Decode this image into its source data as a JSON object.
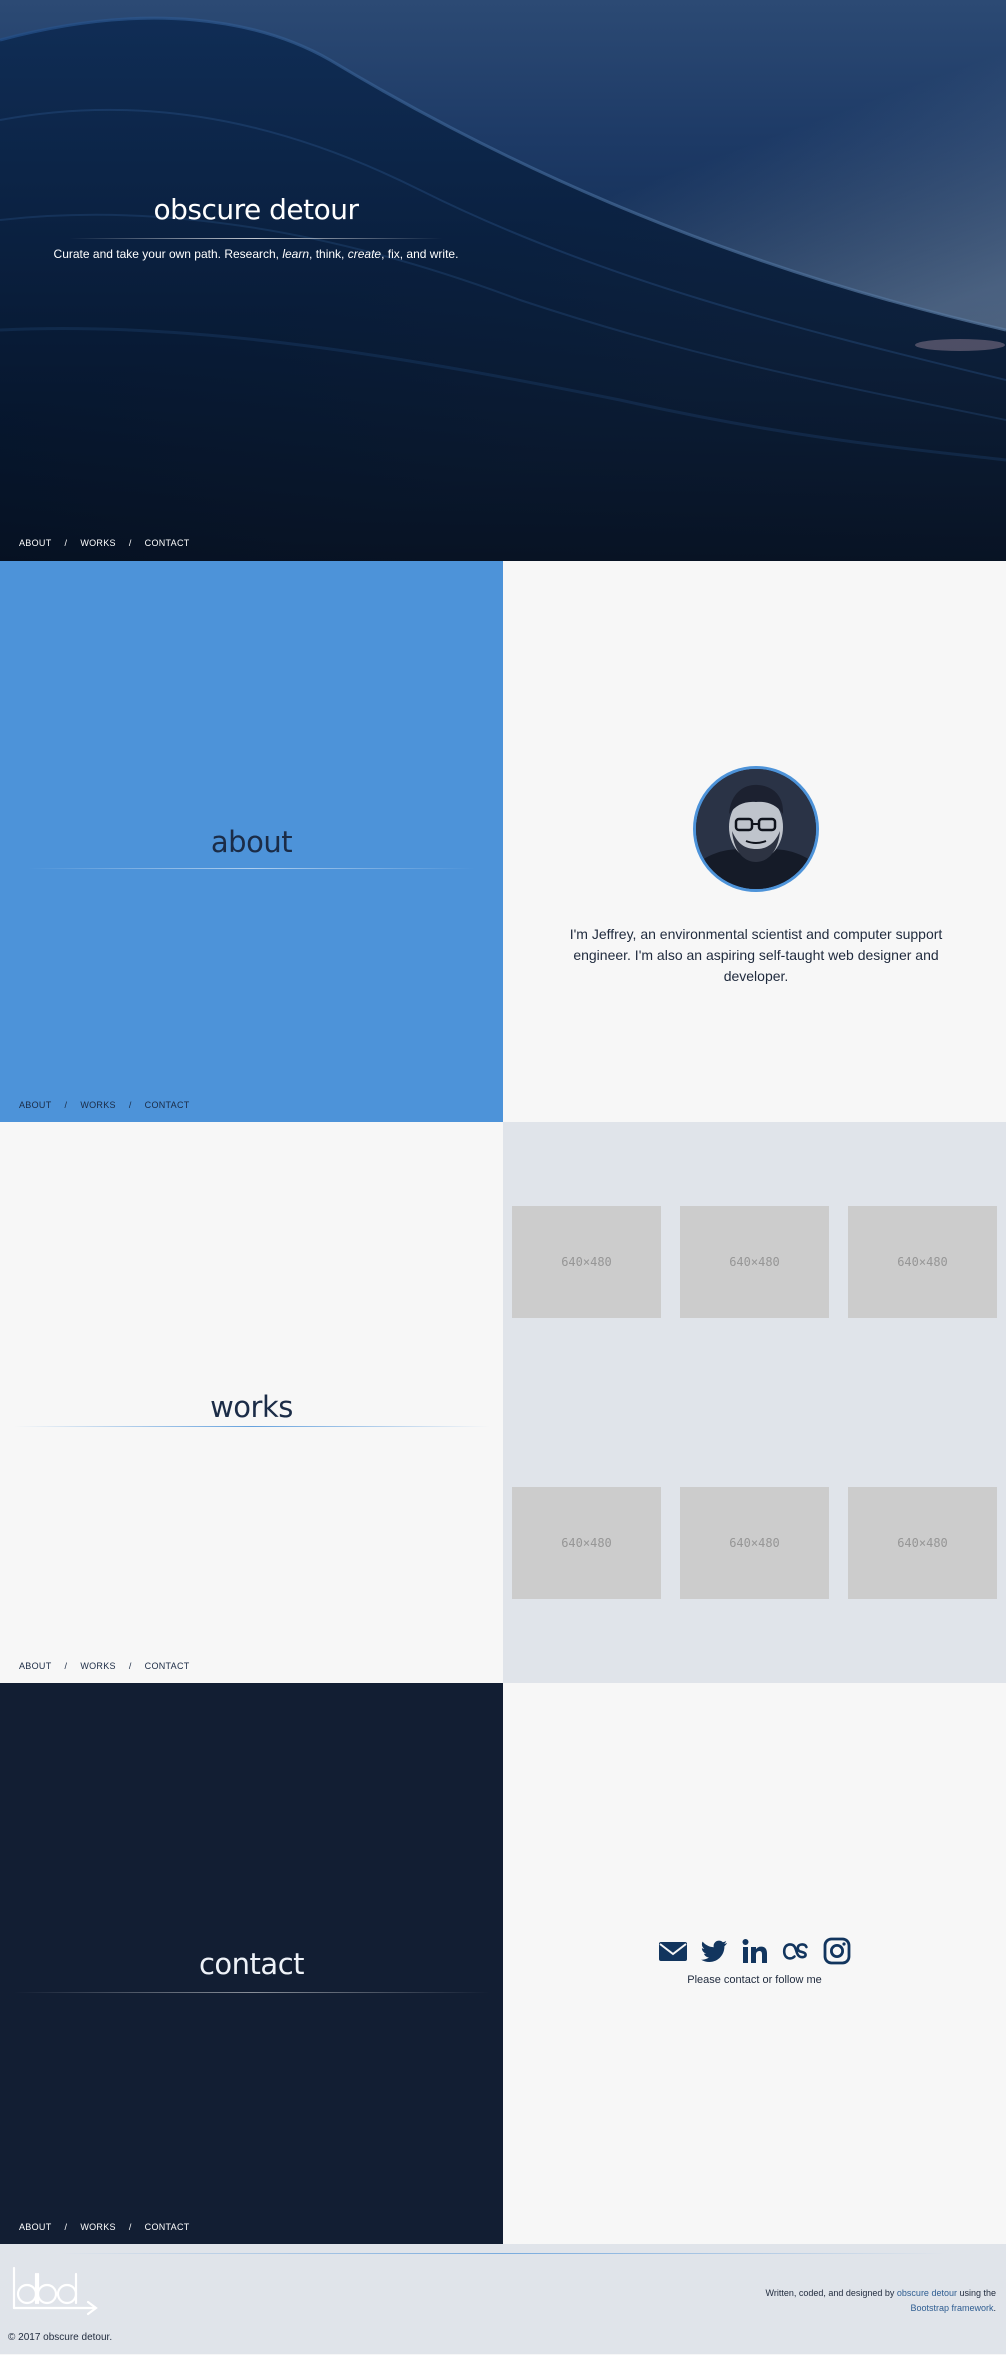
{
  "site_title": "obscure detour",
  "hero": {
    "title": "obscure detour",
    "tagline": {
      "p1": "Curate and take your own path. Research, ",
      "learn": "learn",
      "p2": ", think, ",
      "create": "create",
      "p3": ", fix, and write."
    }
  },
  "nav": {
    "about": "ABOUT",
    "works": "WORKS",
    "contact": "CONTACT",
    "separator": "/"
  },
  "about": {
    "title": "about",
    "bio": "I'm Jeffrey, an environmental scientist and computer support engineer. I'm also an aspiring self-taught web designer and developer."
  },
  "works": {
    "title": "works",
    "thumbnails": [
      "640×480",
      "640×480",
      "640×480",
      "640×480",
      "640×480",
      "640×480"
    ]
  },
  "contact": {
    "title": "contact",
    "note": "Please contact or follow me",
    "icons": [
      "envelope-icon",
      "twitter-icon",
      "linkedin-icon",
      "lastfm-icon",
      "instagram-icon"
    ]
  },
  "footer": {
    "copyright": "© 2017 obscure detour.",
    "credits_p1": "Written, coded, and designed by ",
    "credits_link1": "obscure detour",
    "credits_p2": " using the ",
    "credits_link2": "Bootstrap framework",
    "credits_p3": "."
  },
  "colors": {
    "accent": "#4d93d9",
    "navy": "#121e33",
    "light": "#f7f7f7",
    "pale": "#e0e4ea",
    "placeholder": "#cccccc"
  }
}
